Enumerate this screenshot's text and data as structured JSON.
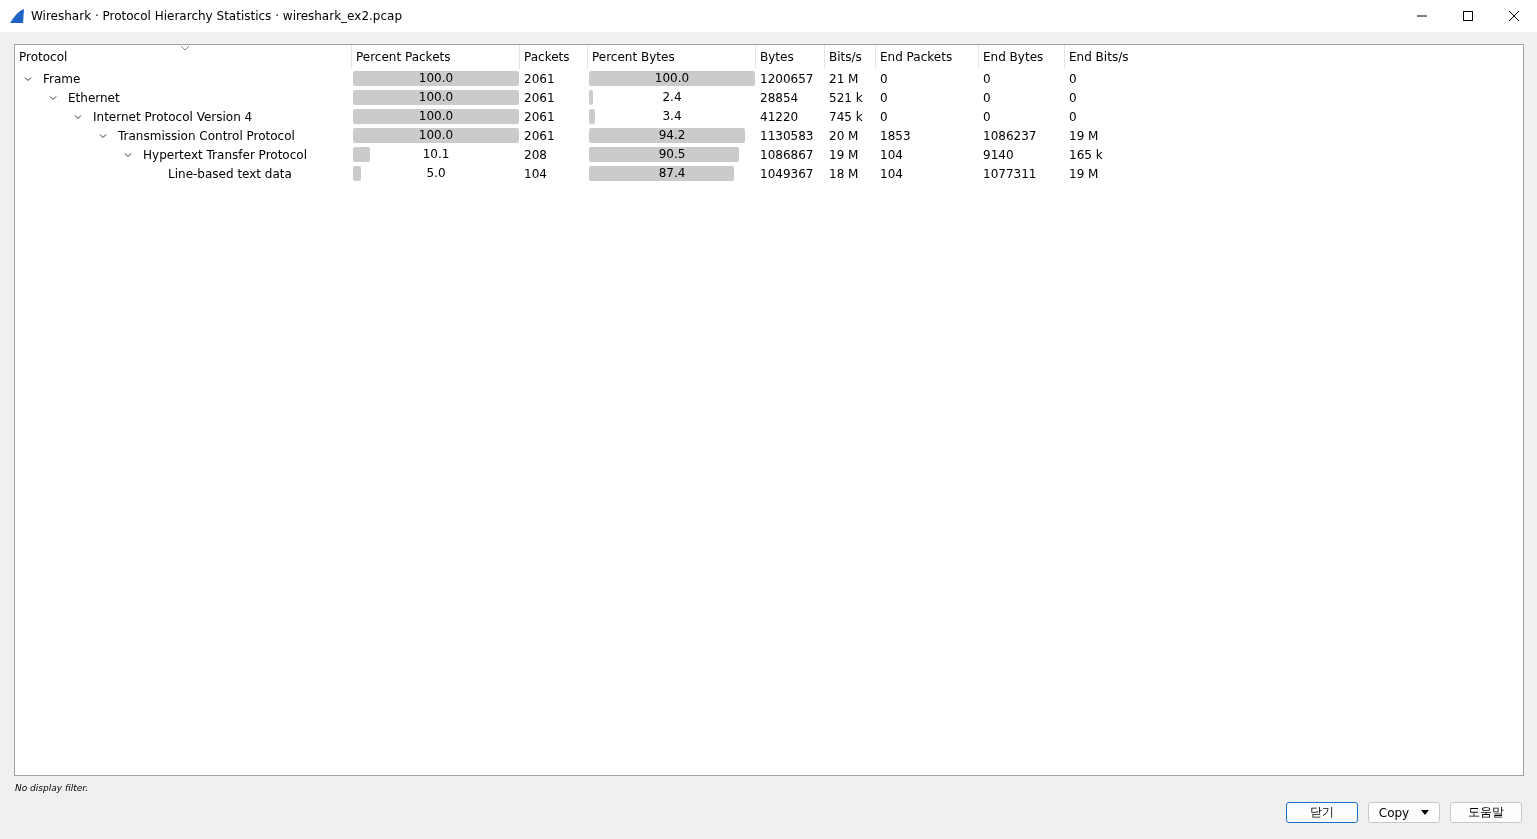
{
  "window": {
    "title": "Wireshark · Protocol Hierarchy Statistics · wireshark_ex2.pcap"
  },
  "table": {
    "columns": [
      "Protocol",
      "Percent Packets",
      "Packets",
      "Percent Bytes",
      "Bytes",
      "Bits/s",
      "End Packets",
      "End Bytes",
      "End Bits/s"
    ],
    "rows": [
      {
        "protocol": "Frame",
        "expanded": true,
        "percent_packets": {
          "text": "100.0",
          "level": 1.0
        },
        "packets": "2061",
        "percent_bytes": {
          "text": "100.0",
          "level": 1.0
        },
        "bytes": "1200657",
        "bits_s": "21 M",
        "end_packets": "0",
        "end_bytes": "0",
        "end_bits_s": "0",
        "children": [
          {
            "protocol": "Ethernet",
            "expanded": true,
            "percent_packets": {
              "text": "100.0",
              "level": 1.0
            },
            "packets": "2061",
            "percent_bytes": {
              "text": "2.4",
              "level": 0.024
            },
            "bytes": "28854",
            "bits_s": "521 k",
            "end_packets": "0",
            "end_bytes": "0",
            "end_bits_s": "0",
            "children": [
              {
                "protocol": "Internet Protocol Version 4",
                "expanded": true,
                "percent_packets": {
                  "text": "100.0",
                  "level": 1.0
                },
                "packets": "2061",
                "percent_bytes": {
                  "text": "3.4",
                  "level": 0.034
                },
                "bytes": "41220",
                "bits_s": "745 k",
                "end_packets": "0",
                "end_bytes": "0",
                "end_bits_s": "0",
                "children": [
                  {
                    "protocol": "Transmission Control Protocol",
                    "expanded": true,
                    "percent_packets": {
                      "text": "100.0",
                      "level": 1.0
                    },
                    "packets": "2061",
                    "percent_bytes": {
                      "text": "94.2",
                      "level": 0.942
                    },
                    "bytes": "1130583",
                    "bits_s": "20 M",
                    "end_packets": "1853",
                    "end_bytes": "1086237",
                    "end_bits_s": "19 M",
                    "children": [
                      {
                        "protocol": "Hypertext Transfer Protocol",
                        "expanded": true,
                        "percent_packets": {
                          "text": "10.1",
                          "level": 0.101
                        },
                        "packets": "208",
                        "percent_bytes": {
                          "text": "90.5",
                          "level": 0.905
                        },
                        "bytes": "1086867",
                        "bits_s": "19 M",
                        "end_packets": "104",
                        "end_bytes": "9140",
                        "end_bits_s": "165 k",
                        "children": [
                          {
                            "protocol": "Line-based text data",
                            "percent_packets": {
                              "text": "5.0",
                              "level": 0.05
                            },
                            "packets": "104",
                            "percent_bytes": {
                              "text": "87.4",
                              "level": 0.874
                            },
                            "bytes": "1049367",
                            "bits_s": "18 M",
                            "end_packets": "104",
                            "end_bytes": "1077311",
                            "end_bits_s": "19 M"
                          }
                        ]
                      }
                    ]
                  }
                ]
              }
            ]
          }
        ]
      }
    ]
  },
  "status": "No display filter.",
  "buttons": [
    {
      "label": "닫기",
      "kind": "default"
    },
    {
      "label": "Copy",
      "kind": "menu"
    },
    {
      "label": "도움말",
      "kind": "plain"
    }
  ]
}
